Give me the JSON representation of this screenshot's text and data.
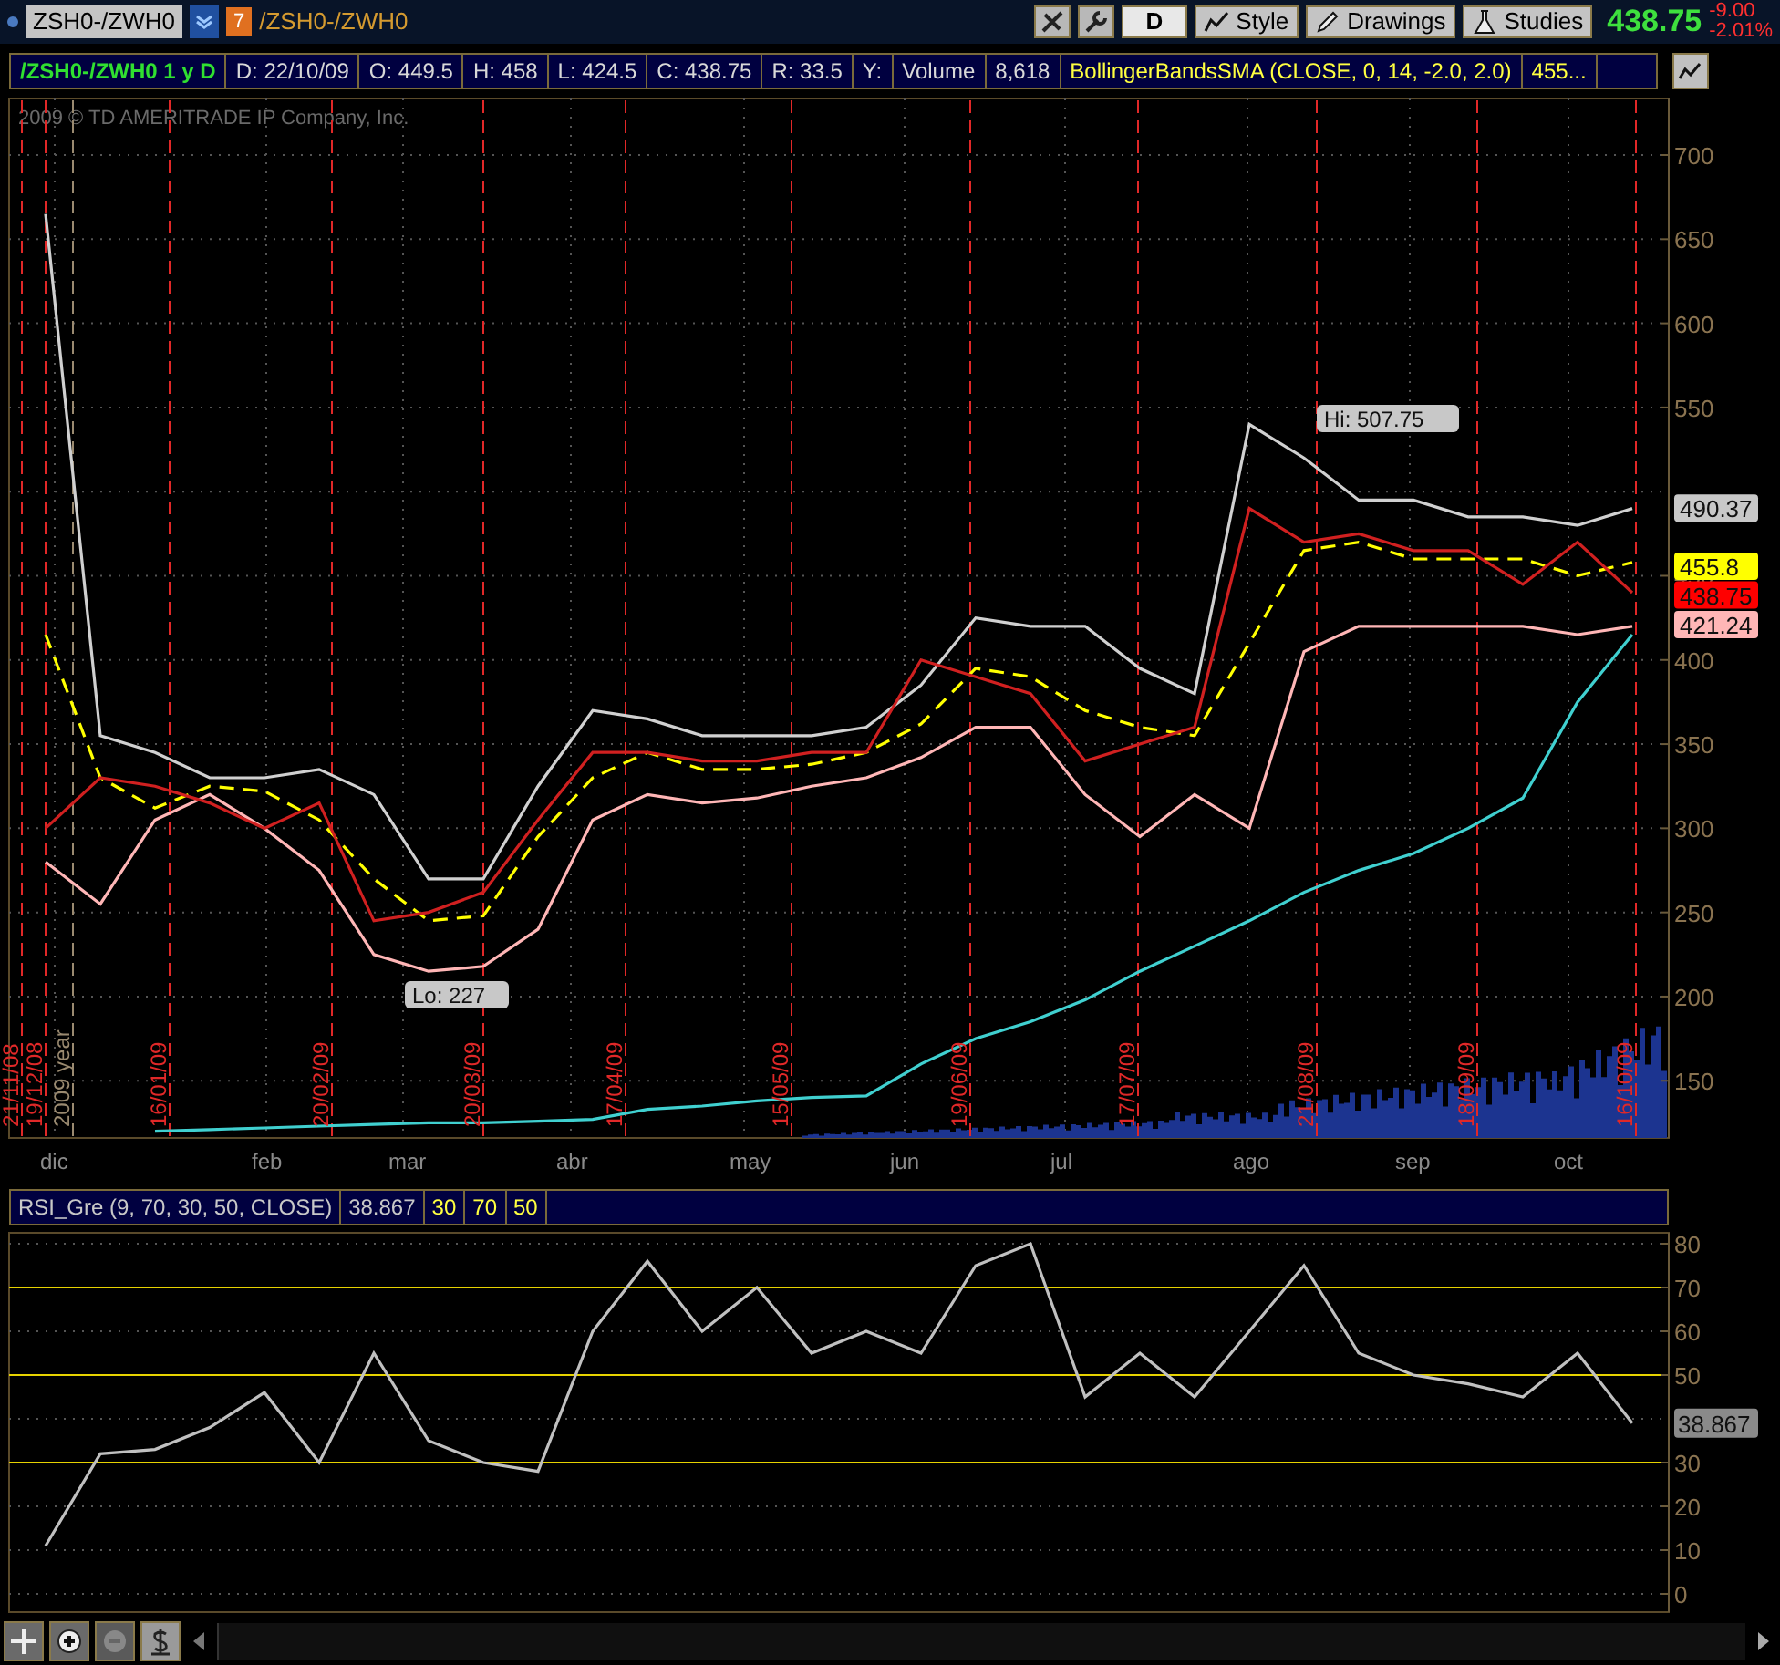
{
  "toolbar": {
    "symbol": "ZSH0-/ZWH0",
    "link_badge": "7",
    "linked_symbol": "/ZSH0-/ZWH0",
    "buttons": [
      {
        "label": "D",
        "kind": "plain"
      },
      {
        "label": "Style",
        "kind": "style"
      },
      {
        "label": "Drawings",
        "kind": "drawings"
      },
      {
        "label": "Studies",
        "kind": "studies"
      }
    ],
    "quote": {
      "last": "438.75",
      "change": "-9.00",
      "change_pct": "-2.01%"
    }
  },
  "info_bar": {
    "title": "/ZSH0-/ZWH0 1 y D",
    "fields": [
      "D: 22/10/09",
      "O: 449.5",
      "H: 458",
      "L: 424.5",
      "C: 438.75",
      "R: 33.5",
      "Y:",
      "Volume",
      "8,618"
    ],
    "study": "BollingerBandsSMA (CLOSE, 0, 14, -2.0, 2.0)",
    "study_value": "455..."
  },
  "price_chart": {
    "copyright": "2009 © TD AMERITRADE IP Company, Inc.",
    "markers": [
      {
        "label": "21/11/08",
        "kind": "date"
      },
      {
        "label": "19/12/08",
        "kind": "date"
      },
      {
        "label": "2009 year",
        "kind": "year"
      },
      {
        "label": "16/01/09",
        "kind": "date"
      },
      {
        "label": "20/02/09",
        "kind": "date"
      },
      {
        "label": "20/03/09",
        "kind": "date"
      },
      {
        "label": "17/04/09",
        "kind": "date"
      },
      {
        "label": "15/05/09",
        "kind": "date"
      },
      {
        "label": "19/06/09",
        "kind": "date"
      },
      {
        "label": "17/07/09",
        "kind": "date"
      },
      {
        "label": "21/08/09",
        "kind": "date"
      },
      {
        "label": "18/09/09",
        "kind": "date"
      },
      {
        "label": "16/10/09",
        "kind": "date"
      }
    ],
    "months": [
      "dic",
      "feb",
      "mar",
      "abr",
      "may",
      "jun",
      "jul",
      "ago",
      "sep",
      "oct"
    ],
    "price_tags": [
      {
        "label": "490.37",
        "color": "#c8c8c8"
      },
      {
        "label": "455.8",
        "color": "#ffff00"
      },
      {
        "label": "438.75",
        "color": "#ff0000"
      },
      {
        "label": "421.24",
        "color": "#ffb6b6"
      }
    ],
    "callouts": [
      {
        "label": "Hi: 507.75",
        "kind": "high"
      },
      {
        "label": "Lo: 227",
        "kind": "low"
      }
    ],
    "chart_data": {
      "type": "line",
      "grid": true,
      "ylim": [
        116,
        733.6
      ],
      "yticks": [
        150,
        200,
        250,
        300,
        350,
        400,
        450,
        550,
        600,
        650,
        700
      ],
      "series": [
        {
          "color": "#d0d0d0",
          "values": [
            665,
            355,
            345,
            330,
            330,
            335,
            320,
            270,
            270,
            325,
            370,
            365,
            355,
            355,
            355,
            360,
            385,
            425,
            420,
            420,
            395,
            380,
            540,
            520,
            495,
            495,
            485,
            485,
            480,
            490
          ]
        },
        {
          "color": "#ffff00",
          "line_style": "dashed",
          "values": [
            415,
            330,
            312,
            325,
            322,
            305,
            270,
            245,
            248,
            295,
            330,
            345,
            335,
            335,
            338,
            345,
            362,
            395,
            390,
            370,
            360,
            355,
            410,
            465,
            470,
            460,
            460,
            460,
            450,
            458
          ]
        },
        {
          "color": "#ffb6b6",
          "values": [
            280,
            255,
            305,
            320,
            300,
            275,
            225,
            215,
            218,
            240,
            305,
            320,
            315,
            318,
            325,
            330,
            342,
            360,
            360,
            320,
            295,
            320,
            300,
            405,
            420,
            420,
            420,
            420,
            415,
            420
          ]
        },
        {
          "color": "#d02020",
          "values": [
            300,
            330,
            325,
            315,
            300,
            315,
            245,
            250,
            262,
            305,
            345,
            345,
            340,
            340,
            345,
            345,
            400,
            390,
            380,
            340,
            350,
            360,
            490,
            470,
            475,
            465,
            465,
            445,
            470,
            440
          ]
        },
        {
          "color": "#40d0d0",
          "values": [
            null,
            null,
            120,
            121,
            122,
            123,
            124,
            125,
            125,
            126,
            127,
            133,
            135,
            138,
            140,
            141,
            160,
            175,
            185,
            198,
            215,
            230,
            245,
            262,
            275,
            285,
            300,
            318,
            375,
            415
          ]
        }
      ]
    }
  },
  "rsi": {
    "title": "RSI_Gre (9, 70, 30, 50, CLOSE)",
    "value": "38.867",
    "levels": [
      "30",
      "70",
      "50"
    ],
    "value_tag": "38.867",
    "chart_data": {
      "type": "line",
      "grid": true,
      "ylim": [
        -4.17,
        82.5
      ],
      "yticks": [
        0,
        10,
        20,
        30,
        50,
        60,
        70,
        80
      ],
      "series": [
        {
          "color": "#c0c0c0",
          "values": [
            11,
            32,
            33,
            38,
            46,
            30,
            55,
            35,
            30,
            28,
            60,
            76,
            60,
            70,
            55,
            60,
            55,
            75,
            80,
            45,
            55,
            45,
            60,
            75,
            55,
            50,
            48,
            45,
            55,
            39
          ]
        }
      ]
    }
  }
}
